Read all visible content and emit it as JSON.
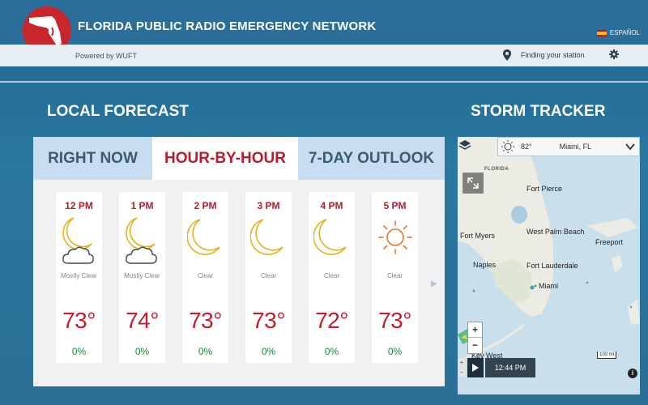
{
  "header": {
    "title": "FLORIDA PUBLIC RADIO EMERGENCY NETWORK",
    "powered_by": "Powered by WUFT",
    "language": "ESPAÑOL",
    "station_link": "Finding your station"
  },
  "forecast": {
    "section_title": "LOCAL FORECAST",
    "tabs": [
      {
        "label": "RIGHT NOW",
        "active": false
      },
      {
        "label": "HOUR-BY-HOUR",
        "active": true
      },
      {
        "label": "7-DAY OUTLOOK",
        "active": false
      }
    ],
    "hours": [
      {
        "time": "12 PM",
        "icon": "moon-cloud-icon",
        "condition": "Mostly Clear",
        "temp": "73°",
        "precip": "0%"
      },
      {
        "time": "1 PM",
        "icon": "moon-cloud-icon",
        "condition": "Mostly Clear",
        "temp": "74°",
        "precip": "0%"
      },
      {
        "time": "2 PM",
        "icon": "moon-icon",
        "condition": "Clear",
        "temp": "73°",
        "precip": "0%"
      },
      {
        "time": "3 PM",
        "icon": "moon-icon",
        "condition": "Clear",
        "temp": "73°",
        "precip": "0%"
      },
      {
        "time": "4 PM",
        "icon": "moon-icon",
        "condition": "Clear",
        "temp": "72°",
        "precip": "0%"
      },
      {
        "time": "5 PM",
        "icon": "sun-icon",
        "condition": "Clear",
        "temp": "73°",
        "precip": "0%"
      }
    ]
  },
  "storm": {
    "section_title": "STORM TRACKER",
    "location_temp": "82°",
    "location_city": "Miami, FL",
    "timestamp": "12:44 PM",
    "scale_label": "100 mi",
    "map_labels": {
      "florida": "FLORIDA",
      "fort_pierce": "Fort Pierce",
      "fort_myers": "Fort Myers",
      "west_palm": "West Palm Beach",
      "freeport": "Freeport",
      "naples": "Naples",
      "fort_lauderdale": "Fort Lauderdale",
      "miami": "Miami",
      "key_west": "Key West"
    },
    "zoom_in": "+",
    "zoom_out": "−"
  },
  "colors": {
    "accent_red": "#b71d2c",
    "precip_green": "#1b8a3a",
    "header_blue": "#2b6e99"
  }
}
